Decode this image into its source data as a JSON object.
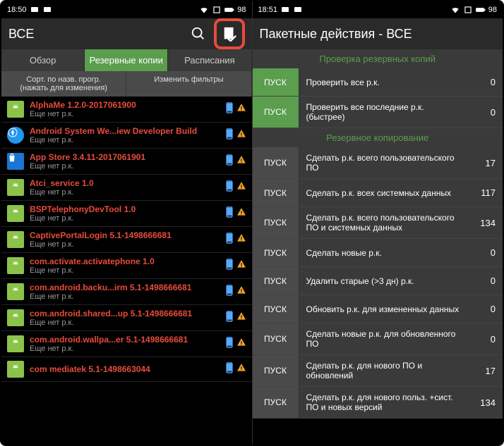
{
  "left": {
    "statusbar": {
      "time": "18:50",
      "battery": "98"
    },
    "header": {
      "title": "ВСЕ"
    },
    "tabs": [
      "Обзор",
      "Резервные копии",
      "Расписания"
    ],
    "subheader": {
      "sort": "Сорт. по назв. прогр.\n(нажать для изменения)",
      "filter": "Изменить фильтры"
    },
    "apps": [
      {
        "name": "AlphaMe 1.2.0-2017061900",
        "status": "Еще нет р.к.",
        "icon": "green"
      },
      {
        "name": "Android System We...iew Developer Build",
        "status": "Еще нет р.к.",
        "icon": "blue"
      },
      {
        "name": "App Store 3.4.11-2017061901",
        "status": "Еще нет р.к.",
        "icon": "bluebag"
      },
      {
        "name": "Atci_service 1.0",
        "status": "Еще нет р.к.",
        "icon": "green"
      },
      {
        "name": "BSPTelephonyDevTool 1.0",
        "status": "Еще нет р.к.",
        "icon": "green"
      },
      {
        "name": "CaptivePortalLogin 5.1-1498666681",
        "status": "Еще нет р.к.",
        "icon": "green"
      },
      {
        "name": "com.activate.activatephone 1.0",
        "status": "Еще нет р.к.",
        "icon": "green"
      },
      {
        "name": "com.android.backu...irm 5.1-1498666681",
        "status": "Еще нет р.к.",
        "icon": "green"
      },
      {
        "name": "com.android.shared...up 5.1-1498666681",
        "status": "Еще нет р.к.",
        "icon": "green"
      },
      {
        "name": "com.android.wallpa...er 5.1-1498666681",
        "status": "Еще нет р.к.",
        "icon": "green"
      },
      {
        "name": "com mediatek 5.1-1498663044",
        "status": "",
        "icon": "green"
      }
    ]
  },
  "right": {
    "statusbar": {
      "time": "18:51",
      "battery": "98"
    },
    "header": {
      "title": "Пакетные действия - ВСЕ"
    },
    "sections": {
      "check_title": "Проверка резервных копий",
      "backup_title": "Резервное копирование"
    },
    "btn": "ПУСК",
    "actions_check": [
      {
        "label": "Проверить все р.к.",
        "count": "0",
        "green": true
      },
      {
        "label": "Проверить все последние р.к. (быстрее)",
        "count": "0",
        "green": true
      }
    ],
    "actions_backup": [
      {
        "label": "Сделать р.к. всего пользовательского ПО",
        "count": "17"
      },
      {
        "label": "Сделать р.к. всех системных данных",
        "count": "117"
      },
      {
        "label": "Сделать р.к. всего пользовательского ПО и системных данных",
        "count": "134"
      },
      {
        "label": "Сделать новые р.к.",
        "count": "0"
      },
      {
        "label": "Удалить старые (>3 дн) р.к.",
        "count": "0"
      },
      {
        "label": "Обновить р.к. для измененных данных",
        "count": "0"
      },
      {
        "label": "Сделать новые р.к. для обновленного ПО",
        "count": "0"
      },
      {
        "label": "Сделать р.к. для нового ПО и обновлений",
        "count": "17"
      },
      {
        "label": "Сделать р.к. для нового польз. +сист. ПО и новых версий",
        "count": "134"
      }
    ]
  }
}
